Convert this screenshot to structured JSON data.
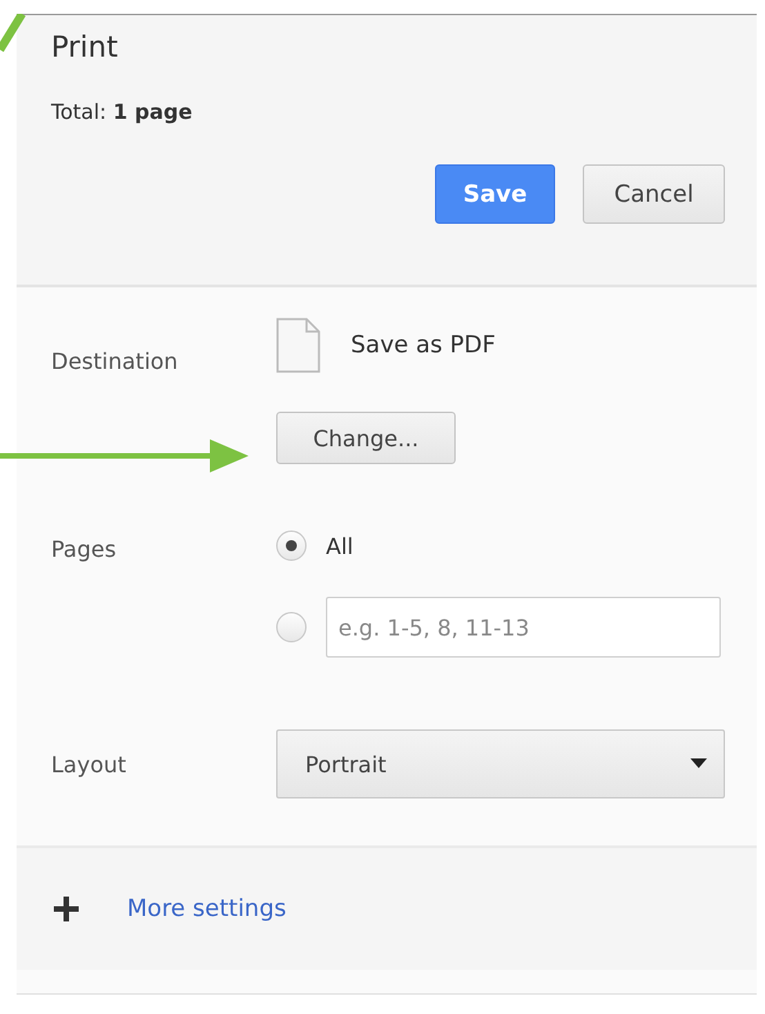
{
  "title": "Print",
  "total": "Total: **1 page**",
  "buttons": [
    {
      "label": "Save",
      "kind": "primary"
    },
    {
      "label": "Cancel",
      "kind": "secondary"
    }
  ],
  "destination": {
    "label": "Destination",
    "name": "Save as PDF",
    "button": "Change..."
  },
  "pages": {
    "label": "Pages",
    "options": [
      {
        "kind": "all",
        "label": "All",
        "selected": true
      },
      {
        "kind": "custom",
        "placeholder": "e.g. 1-5, 8, 11-13",
        "selected": false
      }
    ]
  },
  "layout": {
    "label": "Layout",
    "value": "Portrait"
  },
  "more_settings": {
    "label": "More settings",
    "expanded": false
  }
}
